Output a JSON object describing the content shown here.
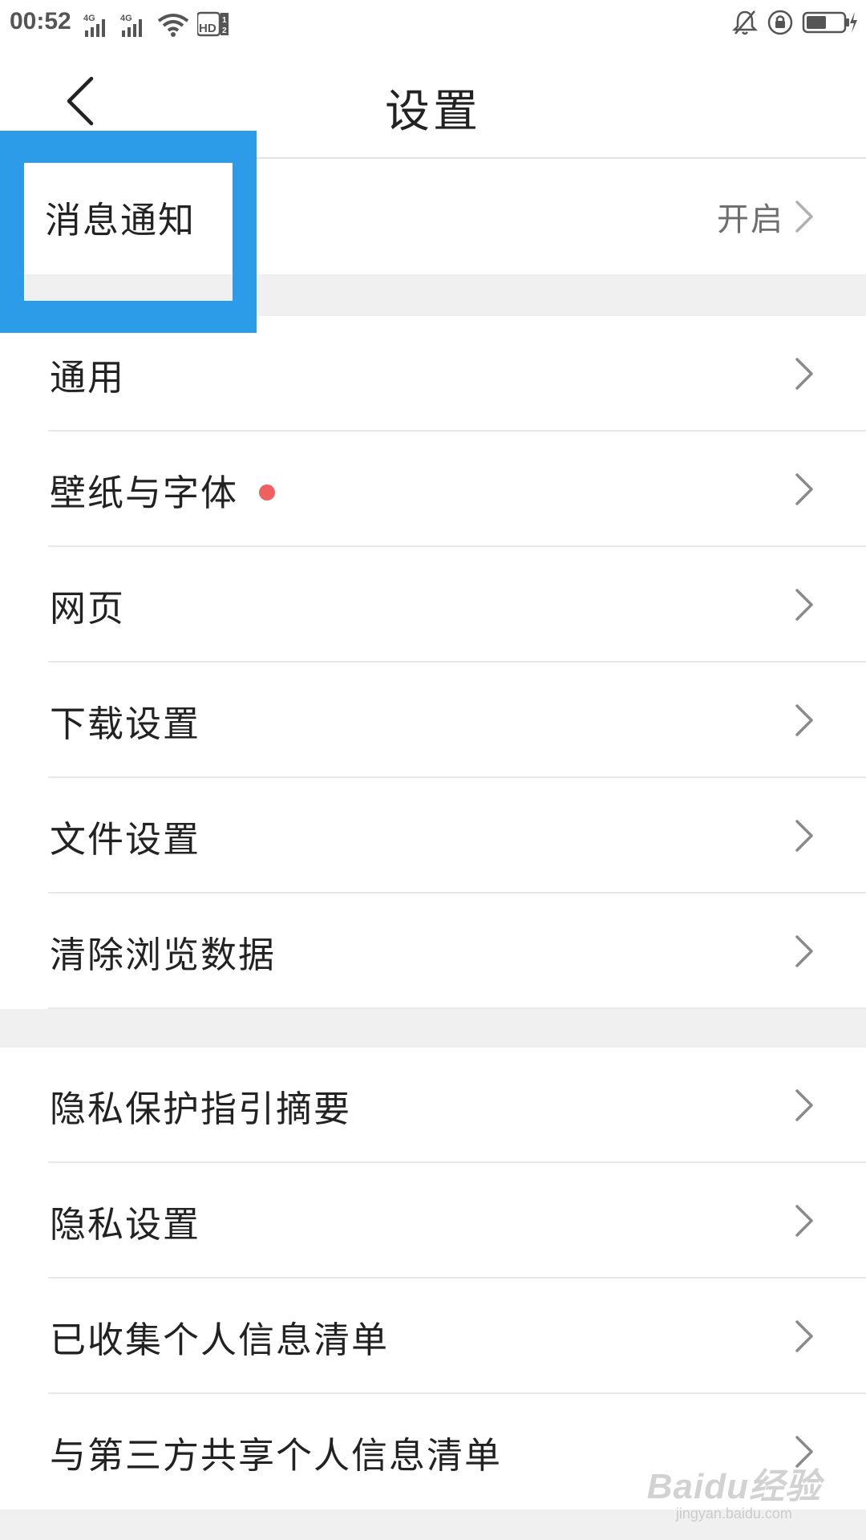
{
  "status_bar": {
    "time": "00:52",
    "network_1": "4G",
    "network_2": "4G",
    "hd_label": "HD",
    "icons": [
      "signal-icon",
      "signal-icon",
      "wifi-icon",
      "hd-volte-icon",
      "bell-muted-icon",
      "lock-rotation-icon",
      "battery-charging-icon"
    ]
  },
  "header": {
    "title": "设置",
    "back_icon": "chevron-left-icon"
  },
  "group_notification": {
    "items": [
      {
        "label": "消息通知",
        "value": "开启"
      }
    ]
  },
  "group_general": {
    "items": [
      {
        "label": "通用"
      },
      {
        "label": "壁纸与字体",
        "has_dot": true
      },
      {
        "label": "网页"
      },
      {
        "label": "下载设置"
      },
      {
        "label": "文件设置"
      },
      {
        "label": "清除浏览数据"
      }
    ]
  },
  "group_privacy": {
    "items": [
      {
        "label": "隐私保护指引摘要"
      },
      {
        "label": "隐私设置"
      },
      {
        "label": "已收集个人信息清单"
      },
      {
        "label": "与第三方共享个人信息清单"
      }
    ]
  },
  "colors": {
    "highlight": "#2c9be8",
    "dot": "#f06060",
    "background": "#f0f0f0"
  },
  "watermark": {
    "logo": "Baidu经验",
    "url": "jingyan.baidu.com"
  }
}
